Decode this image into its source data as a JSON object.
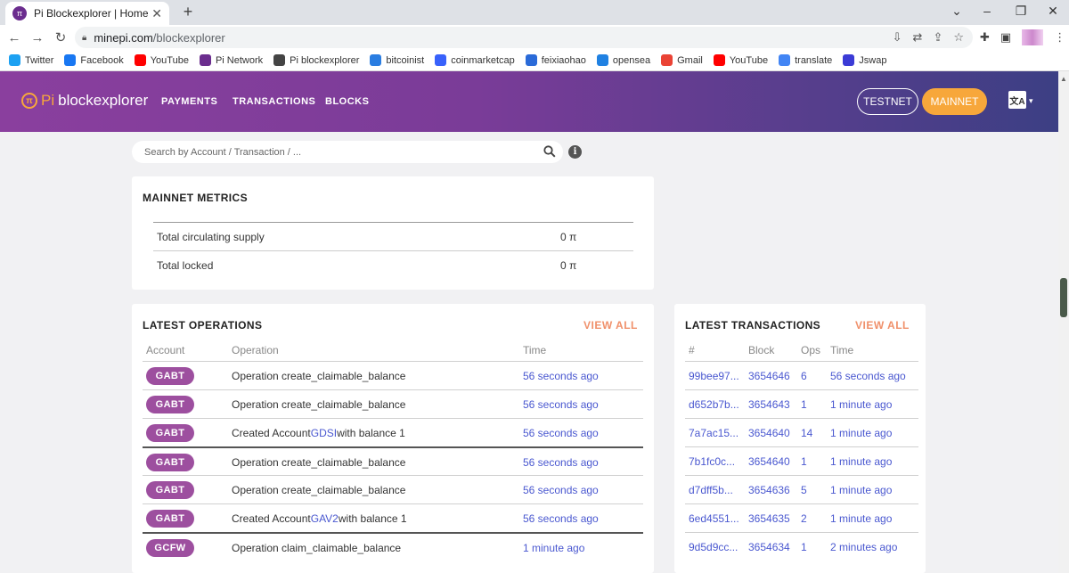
{
  "browser": {
    "tab_title": "Pi Blockexplorer | Home",
    "url_host": "minepi.com",
    "url_path": "/blockexplorer",
    "bookmarks": [
      {
        "label": "Twitter",
        "color": "#1da1f2"
      },
      {
        "label": "Facebook",
        "color": "#1877f2"
      },
      {
        "label": "YouTube",
        "color": "#ff0000"
      },
      {
        "label": "Pi Network",
        "color": "#6b2d8e"
      },
      {
        "label": "Pi blockexplorer",
        "color": "#444444"
      },
      {
        "label": "bitcoinist",
        "color": "#2a7de1"
      },
      {
        "label": "coinmarketcap",
        "color": "#3861fb"
      },
      {
        "label": "feixiaohao",
        "color": "#2a6ad8"
      },
      {
        "label": "opensea",
        "color": "#2081e2"
      },
      {
        "label": "Gmail",
        "color": "#ea4335"
      },
      {
        "label": "YouTube",
        "color": "#ff0000"
      },
      {
        "label": "translate",
        "color": "#4285f4"
      },
      {
        "label": "Jswap",
        "color": "#3b3bd6"
      }
    ]
  },
  "header": {
    "logo_pi": "Pi",
    "logo_text": "blockexplorer",
    "nav": [
      "PAYMENTS",
      "TRANSACTIONS",
      "BLOCKS"
    ],
    "testnet_label": "TESTNET",
    "mainnet_label": "MAINNET",
    "lang_glyph": "文A"
  },
  "search": {
    "placeholder": "Search by Account / Transaction / ..."
  },
  "metrics": {
    "title": "MAINNET METRICS",
    "rows": [
      {
        "label": "Total circulating supply",
        "value": "0 π"
      },
      {
        "label": "Total locked",
        "value": "0 π"
      }
    ]
  },
  "operations": {
    "title": "LATEST OPERATIONS",
    "view_all": "VIEW ALL",
    "headers": {
      "account": "Account",
      "operation": "Operation",
      "time": "Time"
    },
    "rows": [
      {
        "account": "GABT",
        "op_pre": "Operation create_claimable_balance",
        "op_link": "",
        "op_post": "",
        "time": "56 seconds ago"
      },
      {
        "account": "GABT",
        "op_pre": "Operation create_claimable_balance",
        "op_link": "",
        "op_post": "",
        "time": "56 seconds ago"
      },
      {
        "account": "GABT",
        "op_pre": "Created Account ",
        "op_link": "GDSI",
        "op_post": " with balance 1",
        "time": "56 seconds ago"
      },
      {
        "account": "GABT",
        "op_pre": "Operation create_claimable_balance",
        "op_link": "",
        "op_post": "",
        "time": "56 seconds ago"
      },
      {
        "account": "GABT",
        "op_pre": "Operation create_claimable_balance",
        "op_link": "",
        "op_post": "",
        "time": "56 seconds ago"
      },
      {
        "account": "GABT",
        "op_pre": "Created Account ",
        "op_link": "GAV2",
        "op_post": " with balance 1",
        "time": "56 seconds ago"
      },
      {
        "account": "GCFW",
        "op_pre": "Operation claim_claimable_balance",
        "op_link": "",
        "op_post": "",
        "time": "1 minute ago"
      }
    ]
  },
  "transactions": {
    "title": "LATEST TRANSACTIONS",
    "view_all": "VIEW ALL",
    "headers": {
      "hash": "#",
      "block": "Block",
      "ops": "Ops",
      "time": "Time"
    },
    "rows": [
      {
        "hash": "99bee97...",
        "block": "3654646",
        "ops": "6",
        "time": "56 seconds ago"
      },
      {
        "hash": "d652b7b...",
        "block": "3654643",
        "ops": "1",
        "time": "1 minute ago"
      },
      {
        "hash": "7a7ac15...",
        "block": "3654640",
        "ops": "14",
        "time": "1 minute ago"
      },
      {
        "hash": "7b1fc0c...",
        "block": "3654640",
        "ops": "1",
        "time": "1 minute ago"
      },
      {
        "hash": "d7dff5b...",
        "block": "3654636",
        "ops": "5",
        "time": "1 minute ago"
      },
      {
        "hash": "6ed4551...",
        "block": "3654635",
        "ops": "2",
        "time": "1 minute ago"
      },
      {
        "hash": "9d5d9cc...",
        "block": "3654634",
        "ops": "1",
        "time": "2 minutes ago"
      }
    ]
  }
}
